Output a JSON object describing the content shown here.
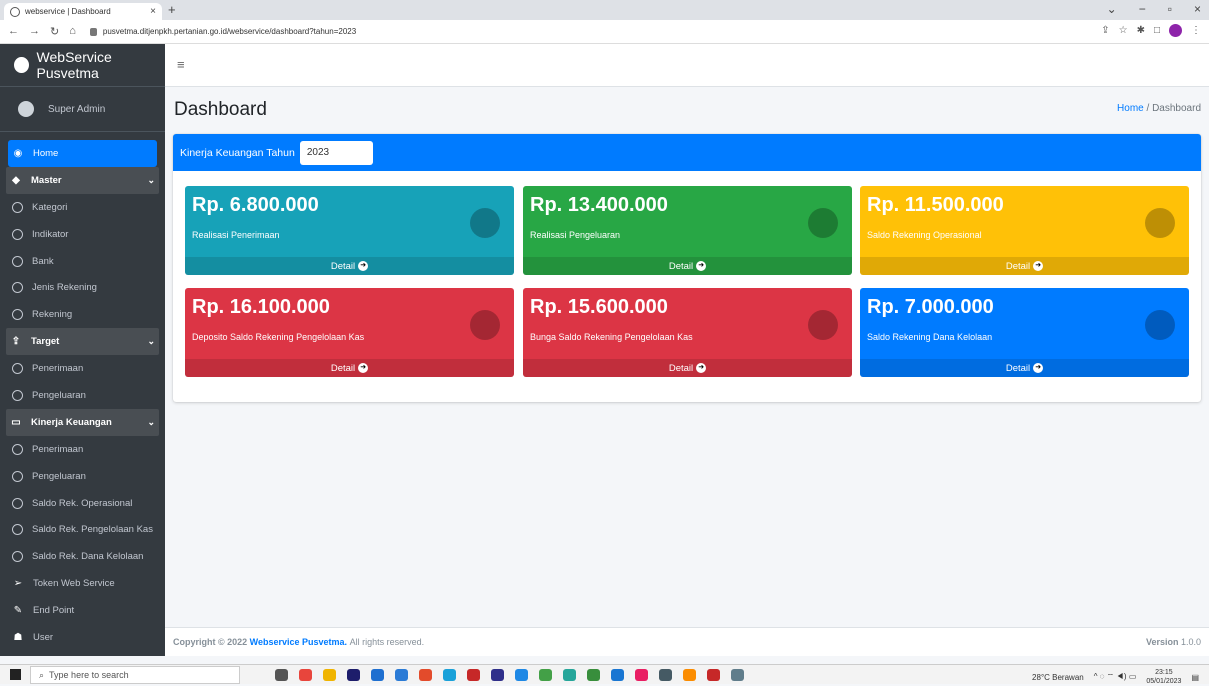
{
  "browser": {
    "tab_title": "webservice | Dashboard",
    "url": "pusvetma.ditjenpkh.pertanian.go.id/webservice/dashboard?tahun=2023"
  },
  "sidebar": {
    "brand": "WebService Pusvetma",
    "user": "Super Admin",
    "items": [
      {
        "label": "Home",
        "type": "active",
        "icon": "dashboard-icon"
      },
      {
        "label": "Master",
        "type": "head",
        "icon": "cubes-icon"
      },
      {
        "label": "Kategori",
        "type": "sub"
      },
      {
        "label": "Indikator",
        "type": "sub"
      },
      {
        "label": "Bank",
        "type": "sub"
      },
      {
        "label": "Jenis Rekening",
        "type": "sub"
      },
      {
        "label": "Rekening",
        "type": "sub"
      },
      {
        "label": "Target",
        "type": "head",
        "icon": "upload-icon"
      },
      {
        "label": "Penerimaan",
        "type": "sub"
      },
      {
        "label": "Pengeluaran",
        "type": "sub"
      },
      {
        "label": "Kinerja Keuangan",
        "type": "head",
        "icon": "laptop-icon"
      },
      {
        "label": "Penerimaan",
        "type": "sub"
      },
      {
        "label": "Pengeluaran",
        "type": "sub"
      },
      {
        "label": "Saldo Rek. Operasional",
        "type": "sub"
      },
      {
        "label": "Saldo Rek. Pengelolaan Kas",
        "type": "sub"
      },
      {
        "label": "Saldo Rek. Dana Kelolaan",
        "type": "sub"
      },
      {
        "label": "Token Web Service",
        "type": "plain",
        "icon": "send-icon"
      },
      {
        "label": "End Point",
        "type": "plain",
        "icon": "pencil-icon"
      },
      {
        "label": "User",
        "type": "plain",
        "icon": "users-icon"
      }
    ]
  },
  "header": {
    "page_title": "Dashboard",
    "breadcrumb_home": "Home",
    "breadcrumb_sep": "/",
    "breadcrumb_current": "Dashboard"
  },
  "card": {
    "title": "Kinerja Keuangan Tahun",
    "year": "2023"
  },
  "boxes": [
    {
      "value": "Rp. 6.800.000",
      "label": "Realisasi Penerimaan",
      "color": "#17a2b8",
      "icon": "shopping-bag-icon"
    },
    {
      "value": "Rp. 13.400.000",
      "label": "Realisasi Pengeluaran",
      "color": "#28a745",
      "icon": "bar-chart-icon"
    },
    {
      "value": "Rp. 11.500.000",
      "label": "Saldo Rekening Operasional",
      "color": "#ffc107",
      "icon": "user-plus-icon"
    },
    {
      "value": "Rp. 16.100.000",
      "label": "Deposito Saldo Rekening Pengelolaan Kas",
      "color": "#dc3545",
      "icon": "pie-chart-icon"
    },
    {
      "value": "Rp. 15.600.000",
      "label": "Bunga Saldo Rekening Pengelolaan Kas",
      "color": "#dc3545",
      "icon": "pie-chart-icon"
    },
    {
      "value": "Rp. 7.000.000",
      "label": "Saldo Rekening Dana Kelolaan",
      "color": "#007bff",
      "icon": "pie-chart-icon"
    }
  ],
  "detail_label": "Detail",
  "footer": {
    "copyright": "Copyright © 2022",
    "link": "Webservice Pusvetma.",
    "rights": "All rights reserved.",
    "version_label": "Version",
    "version": "1.0.0"
  },
  "taskbar": {
    "search_placeholder": "Type here to search",
    "weather": "28°C Berawan",
    "time": "23:15",
    "date": "05/01/2023"
  }
}
